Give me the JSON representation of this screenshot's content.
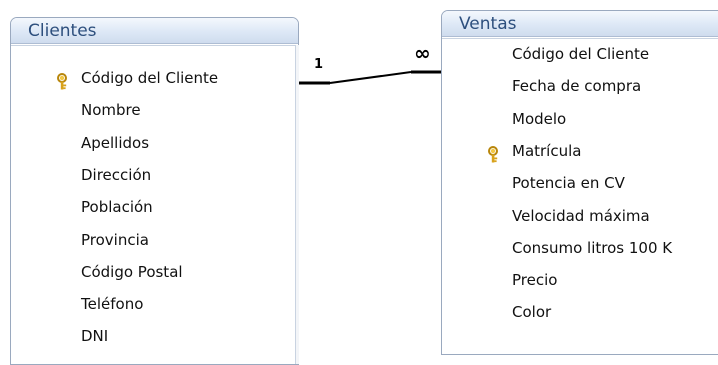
{
  "tables": {
    "clientes": {
      "title": "Clientes",
      "fields": [
        {
          "label": "Código del Cliente",
          "key": true
        },
        {
          "label": "Nombre",
          "key": false
        },
        {
          "label": "Apellidos",
          "key": false
        },
        {
          "label": "Dirección",
          "key": false
        },
        {
          "label": "Población",
          "key": false
        },
        {
          "label": "Provincia",
          "key": false
        },
        {
          "label": "Código Postal",
          "key": false
        },
        {
          "label": "Teléfono",
          "key": false
        },
        {
          "label": "DNI",
          "key": false
        }
      ]
    },
    "ventas": {
      "title": "Ventas",
      "fields": [
        {
          "label": "Código del Cliente",
          "key": false
        },
        {
          "label": "Fecha de compra",
          "key": false
        },
        {
          "label": "Modelo",
          "key": false
        },
        {
          "label": "Matrícula",
          "key": true
        },
        {
          "label": "Potencia en CV",
          "key": false
        },
        {
          "label": "Velocidad máxima",
          "key": false
        },
        {
          "label": "Consumo litros 100 K",
          "key": false
        },
        {
          "label": "Precio",
          "key": false
        },
        {
          "label": "Color",
          "key": false
        }
      ]
    }
  },
  "relationship": {
    "one_side_label": "1",
    "many_side_label": "∞"
  },
  "icons": {
    "primary_key": "key-icon"
  },
  "colors": {
    "title_text": "#2d4f7d",
    "key_gold": "#d8a21c"
  }
}
